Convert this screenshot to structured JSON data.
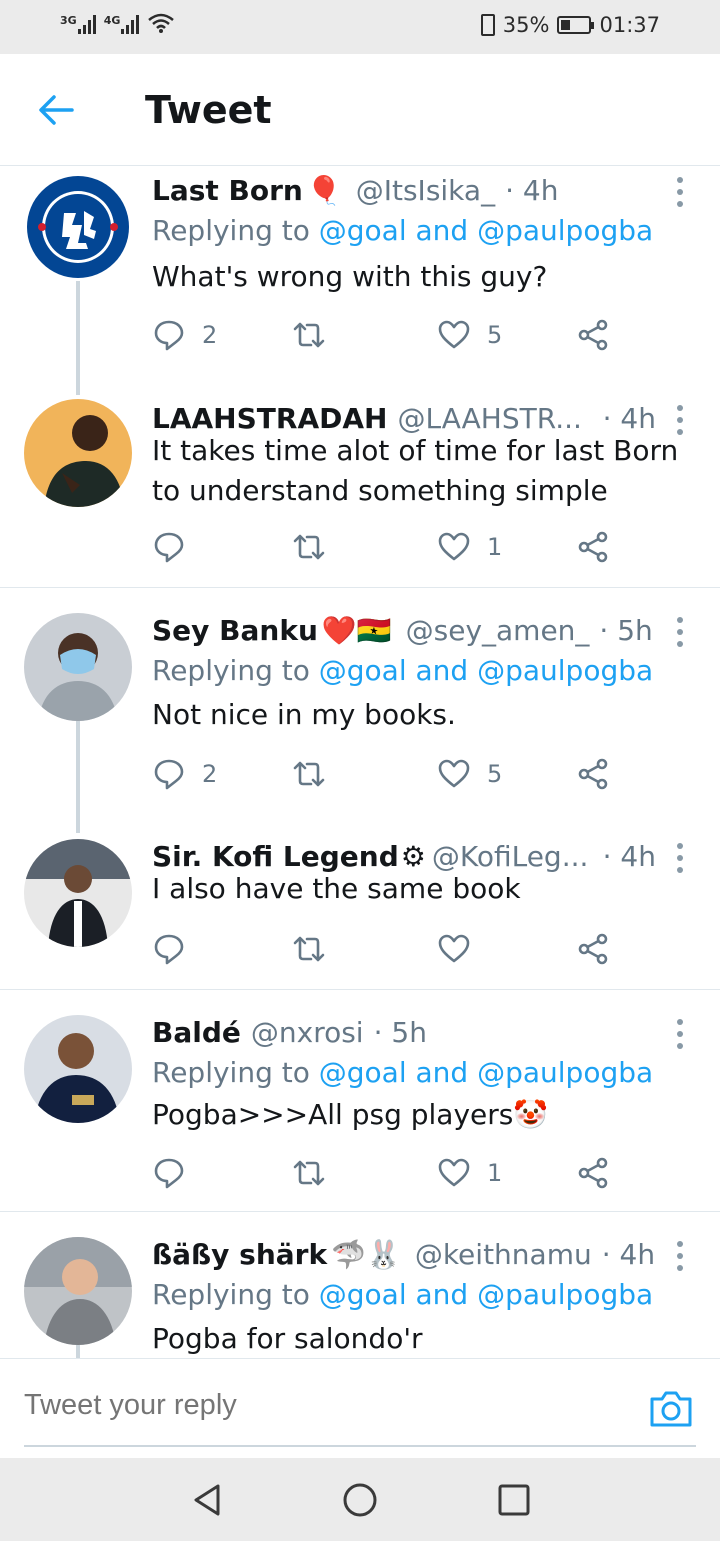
{
  "status_bar": {
    "net1": "3G",
    "net2": "4G",
    "battery_text": "35%",
    "battery_level": 0.35,
    "time": "01:37"
  },
  "header": {
    "title": "Tweet",
    "back_icon": "arrow-left-icon"
  },
  "colors": {
    "accent": "#1da1f2",
    "muted": "#657786",
    "text": "#14171a",
    "divider": "#e1e8ed"
  },
  "tweets": [
    {
      "name": "Last Born",
      "emoji": "🎈",
      "handle": "@ItsIsika_",
      "time": "· 4h",
      "reply_prefix": "Replying to",
      "reply_mentions": "@goal and @paulpogba",
      "text": "What's wrong with this guy?",
      "replies": "2",
      "retweets": "",
      "likes": "5",
      "avatar": "chelsea-crest"
    },
    {
      "name": "LAAHSTRADAH",
      "emoji": "",
      "handle": "@LAAHSTR...",
      "time": "· 4h",
      "text": "It takes time alot of time for last Born to understand something simple",
      "replies": "",
      "retweets": "",
      "likes": "1",
      "avatar": "person-photo"
    },
    {
      "name": "Sey Banku",
      "emoji": "❤️🇬🇭",
      "handle": "@sey_amen_",
      "time": "· 5h",
      "reply_prefix": "Replying to",
      "reply_mentions": "@goal and @paulpogba",
      "text": "Not nice in my books.",
      "replies": "2",
      "retweets": "",
      "likes": "5",
      "avatar": "person-photo"
    },
    {
      "name": "Sir. Kofi Legend",
      "emoji": "⚙",
      "handle": "@KofiLeg...",
      "time": "· 4h",
      "text": "I also have the same book",
      "replies": "",
      "retweets": "",
      "likes": "",
      "avatar": "person-photo"
    },
    {
      "name": "Baldé",
      "emoji": "",
      "handle": "@nxrosi",
      "time": "· 5h",
      "reply_prefix": "Replying to",
      "reply_mentions": "@goal and @paulpogba",
      "text": "Pogba>>>All psg players🤡",
      "replies": "",
      "retweets": "",
      "likes": "1",
      "avatar": "person-photo"
    },
    {
      "name": "ßäßy shärk",
      "emoji": "🦈🐰",
      "handle": "@keithnamu",
      "time": "· 4h",
      "reply_prefix": "Replying to",
      "reply_mentions": "@goal and @paulpogba",
      "text": "Pogba for salondo'r",
      "avatar": "person-photo"
    }
  ],
  "reply_bar": {
    "placeholder": "Tweet your reply",
    "camera_icon": "camera-icon"
  },
  "nav_bar": {
    "back_icon": "triangle-back-icon",
    "home_icon": "circle-home-icon",
    "recents_icon": "square-recents-icon"
  }
}
